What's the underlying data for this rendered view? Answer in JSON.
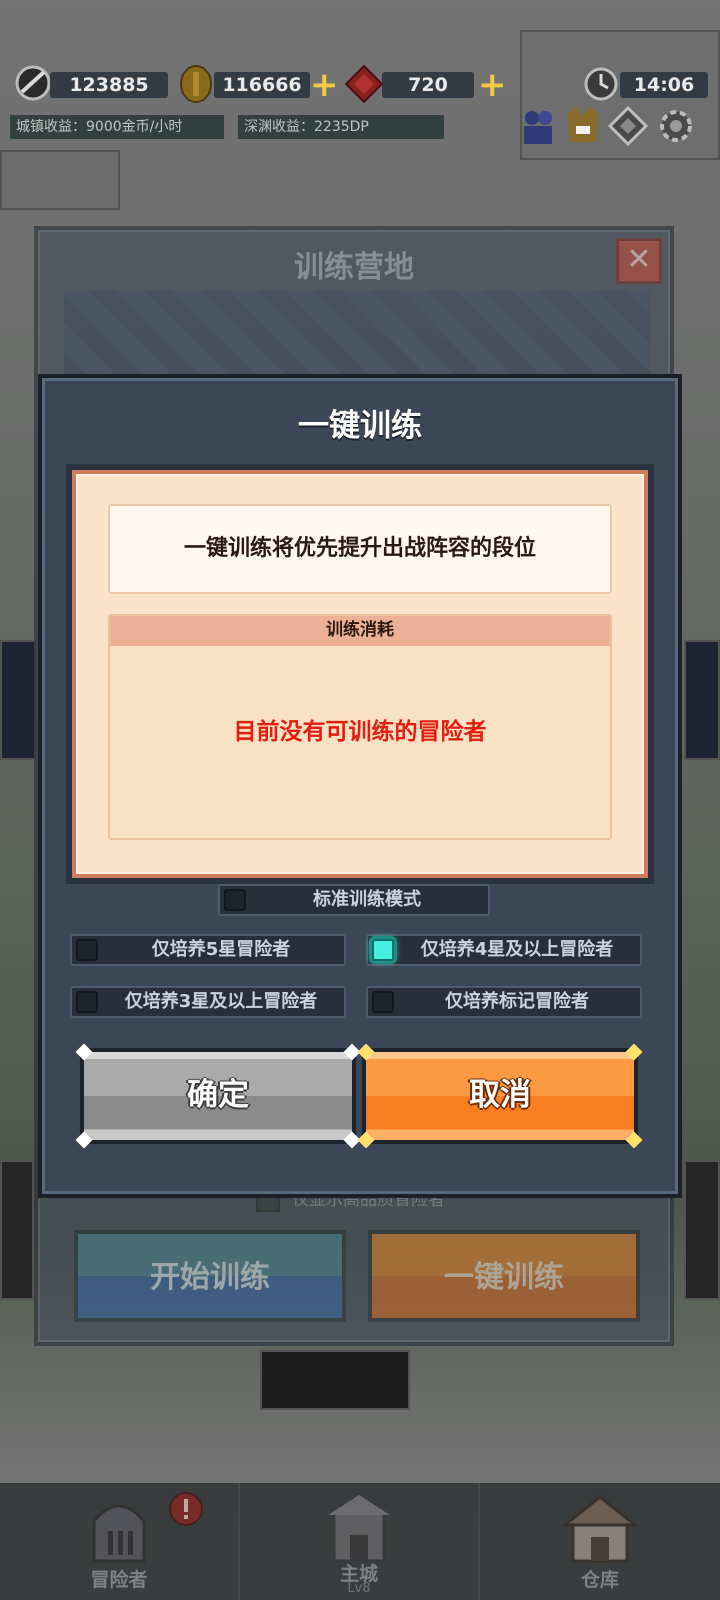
{
  "hud": {
    "power": "123885",
    "gold": "116666",
    "gems": "720",
    "time": "14:06",
    "city_income": "城镇收益：9000金币/小时",
    "abyss_income": "深渊收益：2235DP"
  },
  "camp": {
    "title": "训练营地",
    "show_quality_label": "仅显示高品质冒险者",
    "start_training": "开始训练",
    "one_click_training": "一键训练"
  },
  "dialog": {
    "title": "一键训练",
    "description": "一键训练将优先提升出战阵容的段位",
    "cost_header": "训练消耗",
    "empty_message": "目前没有可训练的冒险者",
    "standard_mode": "标准训练模式",
    "options": [
      {
        "label": "仅培养5星冒险者",
        "checked": false
      },
      {
        "label": "仅培养4星及以上冒险者",
        "checked": true
      },
      {
        "label": "仅培养3星及以上冒险者",
        "checked": false
      },
      {
        "label": "仅培养标记冒险者",
        "checked": false
      }
    ],
    "confirm_label": "确定",
    "cancel_label": "取消"
  },
  "nav": {
    "adventurers": "冒险者",
    "main_city": "主城",
    "main_city_level": "Lv8",
    "warehouse": "仓库"
  },
  "icons": [
    "power-icon",
    "gold-coin-icon",
    "red-gem-icon",
    "clock-icon",
    "party-icon",
    "pet-icon",
    "diamond-badge-icon",
    "gear-icon",
    "close-icon",
    "knight-helmet-icon",
    "alert-icon",
    "castle-icon",
    "house-icon"
  ],
  "colors": {
    "accent_orange": "#fb7d22",
    "checkbox_on": "#46f0e0",
    "empty_red": "#e31d10",
    "panel": "#3b4756"
  }
}
